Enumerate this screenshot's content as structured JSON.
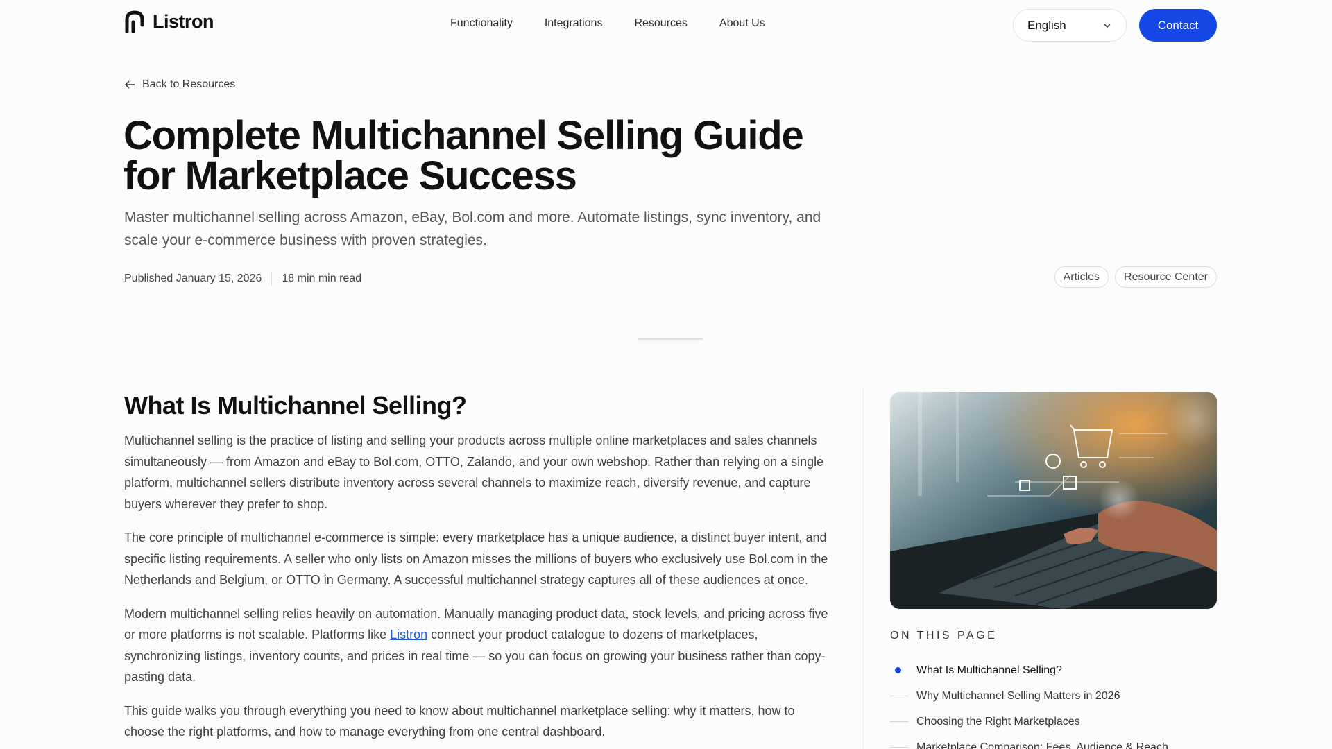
{
  "header": {
    "logo_text": "Listron",
    "nav": [
      "Functionality",
      "Integrations",
      "Resources",
      "About Us"
    ],
    "language": "English",
    "contact_label": "Contact"
  },
  "hero": {
    "back_label": "Back to Resources",
    "title_line1": "Complete Multichannel Selling Guide",
    "title_line2": "for Marketplace Success",
    "subtitle": "Master multichannel selling across Amazon, eBay, Bol.com and more. Automate listings, sync inventory, and scale your e-commerce business with proven strategies.",
    "published": "Published January 15, 2026",
    "read_time": "18 min min read",
    "tags": [
      "Articles",
      "Resource Center"
    ]
  },
  "article": {
    "heading": "What Is Multichannel Selling?",
    "p1": "Multichannel selling is the practice of listing and selling your products across multiple online marketplaces and sales channels simultaneously — from Amazon and eBay to Bol.com, OTTO, Zalando, and your own webshop. Rather than relying on a single platform, multichannel sellers distribute inventory across several channels to maximize reach, diversify revenue, and capture buyers wherever they prefer to shop.",
    "p2": "The core principle of multichannel e-commerce is simple: every marketplace has a unique audience, a distinct buyer intent, and specific listing requirements. A seller who only lists on Amazon misses the millions of buyers who exclusively use Bol.com in the Netherlands and Belgium, or OTTO in Germany. A successful multichannel strategy captures all of these audiences at once.",
    "p3_before": "Modern multichannel selling relies heavily on automation. Manually managing product data, stock levels, and pricing across five or more platforms is not scalable. Platforms like ",
    "p3_link": "Listron",
    "p3_after": " connect your product catalogue to dozens of marketplaces, synchronizing listings, inventory counts, and prices in real time — so you can focus on growing your business rather than copy-pasting data.",
    "p4": "This guide walks you through everything you need to know about multichannel marketplace selling: why it matters, how to choose the right platforms, and how to manage everything from one central dashboard."
  },
  "toc": {
    "heading": "ON THIS PAGE",
    "items": [
      "What Is Multichannel Selling?",
      "Why Multichannel Selling Matters in 2026",
      "Choosing the Right Marketplaces",
      "Marketplace Comparison: Fees, Audience & Reach"
    ]
  },
  "colors": {
    "accent": "#1447e6",
    "link": "#1a5ad6"
  },
  "icons": {
    "back": "arrow-left-icon",
    "language": "chevron-down-icon",
    "logo": "listron-logo-icon"
  }
}
